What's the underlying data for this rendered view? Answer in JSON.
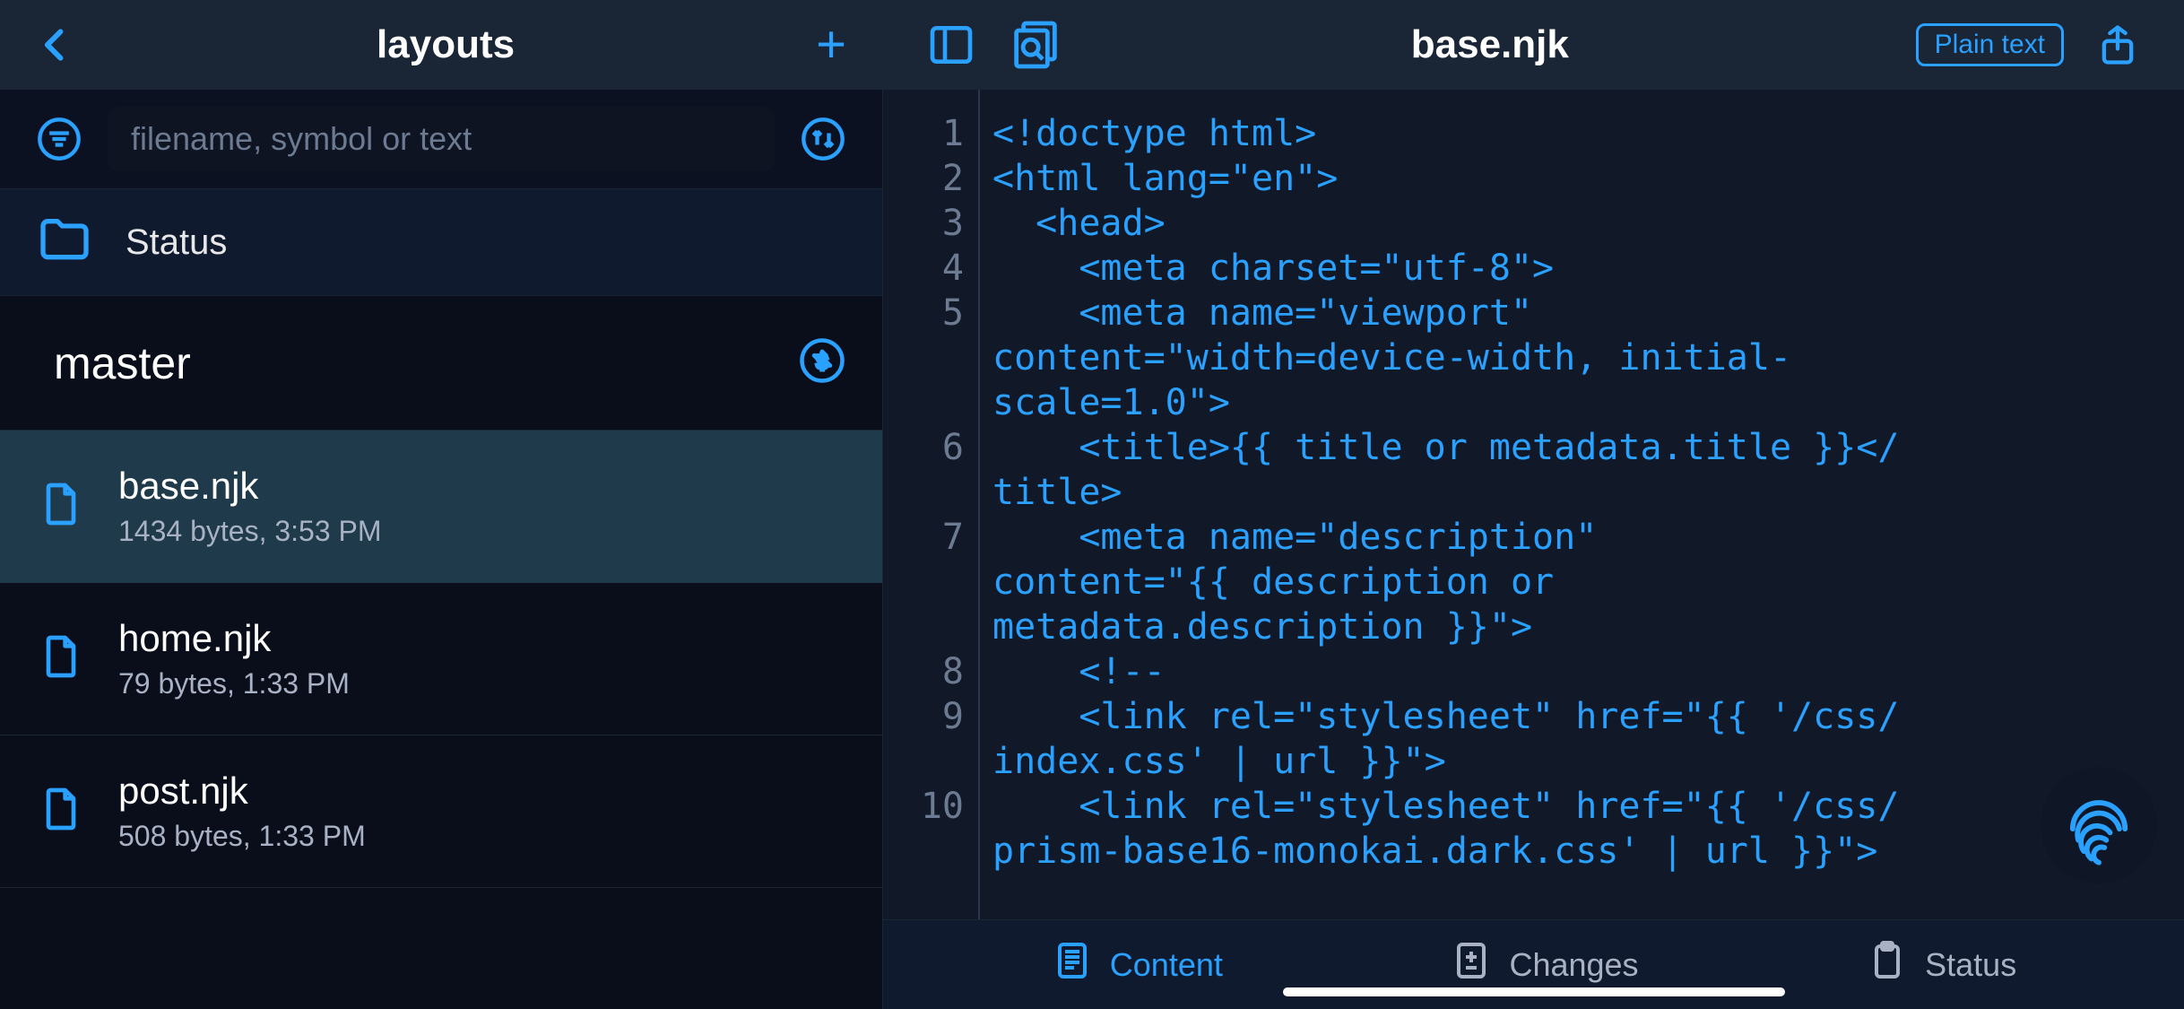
{
  "colors": {
    "accent": "#2aa0ff",
    "bg": "#0a0e1a",
    "panel": "#1a2536"
  },
  "left": {
    "title": "layouts",
    "search_placeholder": "filename, symbol or text",
    "status_label": "Status",
    "branch": "master",
    "files": [
      {
        "name": "base.njk",
        "meta": "1434 bytes, 3:53 PM",
        "selected": true
      },
      {
        "name": "home.njk",
        "meta": "79 bytes, 1:33 PM",
        "selected": false
      },
      {
        "name": "post.njk",
        "meta": "508 bytes, 1:33 PM",
        "selected": false
      }
    ]
  },
  "editor": {
    "filename": "base.njk",
    "language_badge": "Plain text",
    "lines": [
      {
        "n": 1,
        "segs": [
          "<!doctype html>"
        ]
      },
      {
        "n": 2,
        "segs": [
          "<html lang=\"en\">"
        ]
      },
      {
        "n": 3,
        "segs": [
          "  <head>"
        ]
      },
      {
        "n": 4,
        "segs": [
          "    <meta charset=\"utf-8\">"
        ]
      },
      {
        "n": 5,
        "segs": [
          "    <meta name=\"viewport\" ",
          "content=\"width=device-width, initial-",
          "scale=1.0\">"
        ]
      },
      {
        "n": 6,
        "segs": [
          "    <title>{{ title or metadata.title }}</",
          "title>"
        ]
      },
      {
        "n": 7,
        "segs": [
          "    <meta name=\"description\" ",
          "content=\"{{ description or ",
          "metadata.description }}\">"
        ]
      },
      {
        "n": 8,
        "segs": [
          "    <!--"
        ]
      },
      {
        "n": 9,
        "segs": [
          "    <link rel=\"stylesheet\" href=\"{{ '/css/",
          "index.css' | url }}\">"
        ]
      },
      {
        "n": 10,
        "segs": [
          "    <link rel=\"stylesheet\" href=\"{{ '/css/",
          "prism-base16-monokai.dark.css' | url }}\">"
        ]
      }
    ]
  },
  "bottom_tabs": [
    {
      "id": "content",
      "label": "Content",
      "active": true
    },
    {
      "id": "changes",
      "label": "Changes",
      "active": false
    },
    {
      "id": "status",
      "label": "Status",
      "active": false
    }
  ]
}
